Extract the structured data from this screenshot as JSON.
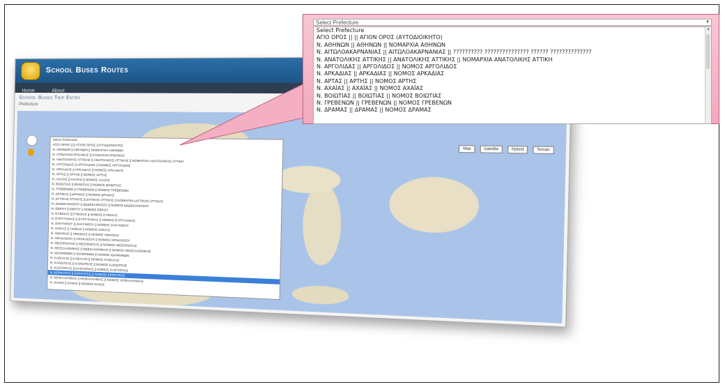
{
  "app": {
    "title": "School Buses Routes",
    "nav": [
      "Home",
      "About"
    ],
    "section_title": "School Buses Trip Entry",
    "prefecture_label": "Prefecture"
  },
  "map": {
    "type_buttons": [
      "Map",
      "Satellite",
      "Hybrid",
      "Terrain"
    ]
  },
  "zoom_dropdown": {
    "selected": "Select Prefecture",
    "options": [
      "Select Prefecture",
      "ΑΓΙΟ ΟΡΟΣ || || ΑΓΙΟΝ ΟΡΟΣ (ΑΥΤΟΔΙΟΙΚΗΤΟ)",
      "Ν. ΑΘΗΝΩΝ || ΑΘΗΝΩΝ || ΝΟΜΑΡΧΙΑ ΑΘΗΝΩΝ",
      "Ν. ΑΙΤΩΛΟΑΚΑΡΝΑΝΙΑΣ || ΑΙΤΩΛΟΑΚΑΡΝΑΝΙΑΣ || ?????????? ??????????????? ?????? ??????????????",
      "Ν. ΑΝΑΤΟΛΙΚΗΣ ΑΤΤΙΚΗΣ || ΑΝΑΤΟΛΙΚΗΣ ΑΤΤΙΚΗΣ || ΝΟΜΑΡΧΙΑ ΑΝΑΤΟΛΙΚΗΣ ΑΤΤΙΚΗ",
      "Ν. ΑΡΓΟΛΙΔΑΣ || ΑΡΓΟΛΙΔΟΣ || ΝΟΜΟΣ ΑΡΓΟΛΙΔΟΣ",
      "Ν. ΑΡΚΑΔΙΑΣ || ΑΡΚΑΔΙΑΣ || ΝΟΜΟΣ ΑΡΚΑΔΙΑΣ",
      "Ν. ΑΡΤΑΣ || ΑΡΤΗΣ || ΝΟΜΟΣ ΑΡΤΗΣ",
      "Ν. ΑΧΑΪΑΣ || ΑΧΑΪΑΣ || ΝΟΜΟΣ ΑΧΑΪΑΣ",
      "Ν. ΒΟΙΩΤΙΑΣ || ΒΟΙΩΤΙΑΣ || ΝΟΜΟΣ ΒΟΙΩΤΙΑΣ",
      "Ν. ΓΡΕΒΕΝΩΝ || ΓΡΕΒΕΝΩΝ || ΝΟΜΟΣ ΓΡΕΒΕΝΩΝ",
      "Ν. ΔΡΑΜΑΣ || ΔΡΑΜΑΣ || ΝΟΜΟΣ ΔΡΑΜΑΣ"
    ]
  },
  "small_dropdown": {
    "options": [
      "Select Prefecture",
      "ΑΓΙΟ ΟΡΟΣ || || ΑΓΙΟΝ ΟΡΟΣ (ΑΥΤΟΔΙΟΙΚΗΤΟ)",
      "Ν. ΑΘΗΝΩΝ || ΑΘΗΝΩΝ || ΝΟΜΑΡΧΙΑ ΑΘΗΝΩΝ",
      "Ν. ΑΙΤΩΛΟΑΚΑΡΝΑΝΙΑΣ || ΑΙΤΩΛΟΑΚΑΡΝΑΝΙΑΣ",
      "Ν. ΑΝΑΤΟΛΙΚΗΣ ΑΤΤΙΚΗΣ || ΑΝΑΤΟΛΙΚΗΣ ΑΤΤΙΚΗΣ || ΝΟΜΑΡΧΙΑ ΑΝΑΤΟΛΙΚΗΣ ΑΤΤΙΚΗ",
      "Ν. ΑΡΓΟΛΙΔΑΣ || ΑΡΓΟΛΙΔΟΣ || ΝΟΜΟΣ ΑΡΓΟΛΙΔΟΣ",
      "Ν. ΑΡΚΑΔΙΑΣ || ΑΡΚΑΔΙΑΣ || ΝΟΜΟΣ ΑΡΚΑΔΙΑΣ",
      "Ν. ΑΡΤΑΣ || ΑΡΤΗΣ || ΝΟΜΟΣ ΑΡΤΗΣ",
      "Ν. ΑΧΑΪΑΣ || ΑΧΑΪΑΣ || ΝΟΜΟΣ ΑΧΑΪΑΣ",
      "Ν. ΒΟΙΩΤΙΑΣ || ΒΟΙΩΤΙΑΣ || ΝΟΜΟΣ ΒΟΙΩΤΙΑΣ",
      "Ν. ΓΡΕΒΕΝΩΝ || ΓΡΕΒΕΝΩΝ || ΝΟΜΟΣ ΓΡΕΒΕΝΩΝ",
      "Ν. ΔΡΑΜΑΣ || ΔΡΑΜΑΣ || ΝΟΜΟΣ ΔΡΑΜΑΣ",
      "Ν. ΔΥΤΙΚΗΣ ΑΤΤΙΚΗΣ || ΔΥΤΙΚΗΣ ΑΤΤΙΚΗΣ || ΝΟΜΑΡΧΙΑ ΔΥΤΙΚΗΣ ΑΤΤΙΚΗΣ",
      "Ν. ΔΩΔΕΚΑΝΗΣΟΥ || ΔΩΔΕΚΑΝΗΣΟΥ || ΝΟΜΟΣ ΔΩΔΕΚΑΝΗΣΟΥ",
      "Ν. ΕΒΡΟΥ || ΕΒΡΟΥ || ΝΟΜΟΣ ΕΒΡΟΥ",
      "Ν. ΕΥΒΟΙΑΣ || ΕΥΒΟΙΑΣ || ΝΟΜΟΣ ΕΥΒΟΙΑΣ",
      "Ν. ΕΥΡΥΤΑΝΙΑΣ || ΕΥΡΥΤΑΝΙΑΣ || ΝΟΜΟΣ ΕΥΡΥΤΑΝΙΑΣ",
      "Ν. ΖΑΚΥΝΘΟΥ || ΖΑΚΥΝΘΟΥ || ΝΟΜΟΣ ΖΑΚΥΝΘΟΥ",
      "Ν. ΗΛΕΙΑΣ || ΗΛΕΙΑΣ || ΝΟΜΟΣ ΗΛΕΙΑΣ",
      "Ν. ΗΜΑΘΙΑΣ || ΗΜΑΘΙΑΣ || ΝΟΜΟΣ ΗΜΑΘΙΑΣ",
      "Ν. ΗΡΑΚΛΕΙΟΥ || ΗΡΑΚΛΕΙΟΥ || ΝΟΜΟΣ ΗΡΑΚΛΕΙΟΥ",
      "Ν. ΘΕΣΠΡΩΤΙΑΣ || ΘΕΣΠΡΩΤΙΑΣ || ΝΟΜΟΣ ΘΕΣΠΡΩΤΙΑΣ",
      "Ν. ΘΕΣΣΑΛΟΝΙΚΗΣ || ΘΕΣΣΑΛΟΝΙΚΗΣ || ΝΟΜΟΣ ΘΕΣΣΑΛΟΝΙΚΗΣ",
      "Ν. ΙΩΑΝΝΙΝΩΝ || ΙΩΑΝΝΙΝΩΝ || ΝΟΜΟΣ ΙΩΑΝΝΙΝΩΝ",
      "Ν. ΚΑΒΑΛΑΣ || ΚΑΒΑΛΑΣ || ΝΟΜΟΣ ΚΑΒΑΛΑΣ",
      "Ν. ΚΑΡΔΙΤΣΑΣ || ΚΑΡΔΙΤΣΗΣ || ΝΟΜΟΣ ΚΑΡΔΙΤΣΗΣ",
      "Ν. ΚΑΣΤΟΡΙΑΣ || ΚΑΣΤΟΡΙΑΣ || ΝΟΜΟΣ ΚΑΣΤΟΡΙΑΣ",
      "Ν. ΚΕΡΚΥΡΑΣ || ΚΕΡΚΥΡΑΣ || ΝΟΜΟΣ ΚΕΡΚΥΡΑΣ",
      "Ν. ΚΕΦΑΛΛΗΝΙΑΣ || ΚΕΦΑΛΛΗΝΙΑΣ || ΝΟΜΟΣ ΚΕΦΑΛΛΗΝΙΑΣ",
      "Ν. ΚΙΛΚΙΣ || ΚΙΛΚΙΣ || ΝΟΜΟΣ ΚΙΛΚΙΣ"
    ],
    "selected_index": 27
  }
}
